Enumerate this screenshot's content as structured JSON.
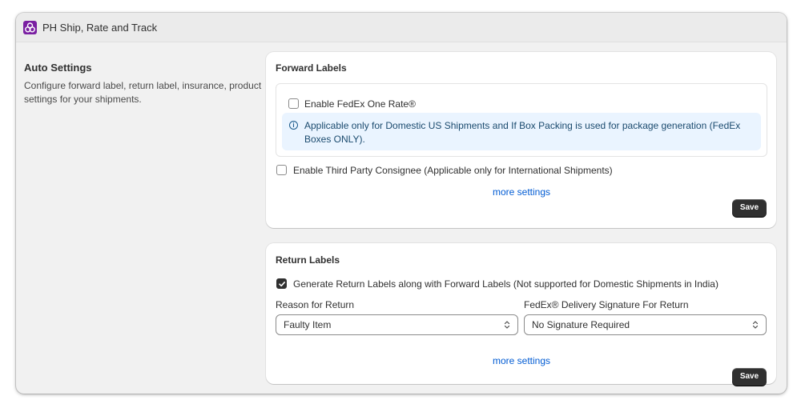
{
  "app": {
    "title": "PH Ship, Rate and Track",
    "icon": "app-logo-icon",
    "brand_color": "#7a1fa2"
  },
  "auto_settings": {
    "heading": "Auto Settings",
    "description": "Configure forward label, return label, insurance, product settings for your shipments."
  },
  "forward_labels": {
    "title": "Forward Labels",
    "fedex_one_rate": {
      "label": "Enable FedEx One Rate®",
      "checked": false
    },
    "info": {
      "icon": "info-icon",
      "text": "Applicable only for Domestic US Shipments and If Box Packing is used for package generation (FedEx Boxes ONLY)."
    },
    "third_party": {
      "label": "Enable Third Party Consignee (Applicable only for International Shipments)",
      "checked": false
    },
    "more_settings": "more settings",
    "save_label": "Save"
  },
  "return_labels": {
    "title": "Return Labels",
    "generate": {
      "label": "Generate Return Labels along with Forward Labels (Not supported for Domestic Shipments in India)",
      "checked": true
    },
    "reason": {
      "label": "Reason for Return",
      "value": "Faulty Item"
    },
    "signature": {
      "label": "FedEx® Delivery Signature For Return",
      "value": "No Signature Required"
    },
    "more_settings": "more settings",
    "save_label": "Save"
  },
  "colors": {
    "link": "#005bd3",
    "info_background": "#eaf4ff",
    "button": "#303030"
  }
}
